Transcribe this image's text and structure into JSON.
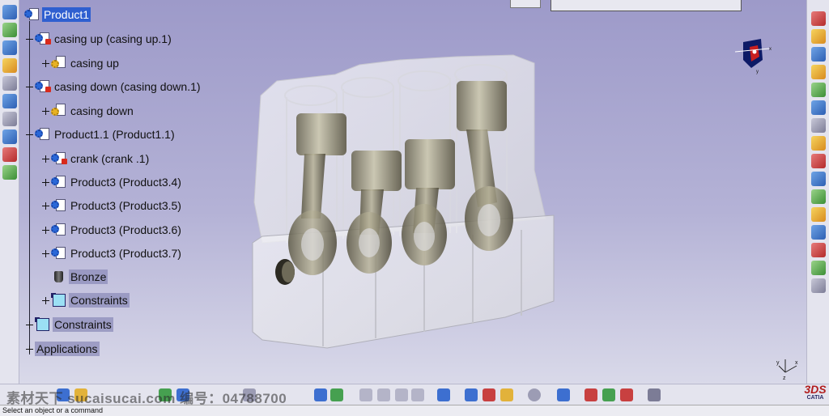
{
  "spec_tree": {
    "root": "Product1",
    "items": [
      {
        "label": "casing up (casing up.1)",
        "icon": "product-icon"
      },
      {
        "label": "casing up",
        "icon": "part-icon"
      },
      {
        "label": "casing down (casing down.1)",
        "icon": "product-icon"
      },
      {
        "label": "casing down",
        "icon": "part-icon"
      },
      {
        "label": "Product1.1 (Product1.1)",
        "icon": "product-icon"
      },
      {
        "label": "crank   (crank  .1)",
        "icon": "product-icon"
      },
      {
        "label": "Product3 (Product3.4)",
        "icon": "product-icon"
      },
      {
        "label": "Product3 (Product3.5)",
        "icon": "product-icon"
      },
      {
        "label": "Product3 (Product3.6)",
        "icon": "product-icon"
      },
      {
        "label": "Product3 (Product3.7)",
        "icon": "product-icon"
      },
      {
        "label": "Bronze",
        "icon": "material-icon"
      },
      {
        "label": "Constraints",
        "icon": "constraints-icon"
      },
      {
        "label": "Constraints",
        "icon": "constraints-icon"
      },
      {
        "label": "Applications",
        "icon": "none"
      }
    ]
  },
  "compass": {
    "axis_x": "x",
    "axis_y": "y"
  },
  "axis_triad": {
    "x": "x",
    "y": "y",
    "z": "z"
  },
  "status_bar": {
    "message": "Select an object or a command"
  },
  "watermark": {
    "text": "素材天下 sucaisucai.com  编号：04788700"
  },
  "logo": {
    "brand": "3DS",
    "product": "CATIA"
  },
  "colors": {
    "viewport_top": "#9d9ac9",
    "viewport_bottom": "#d9d9e9",
    "selection": "#2f5fd0"
  }
}
